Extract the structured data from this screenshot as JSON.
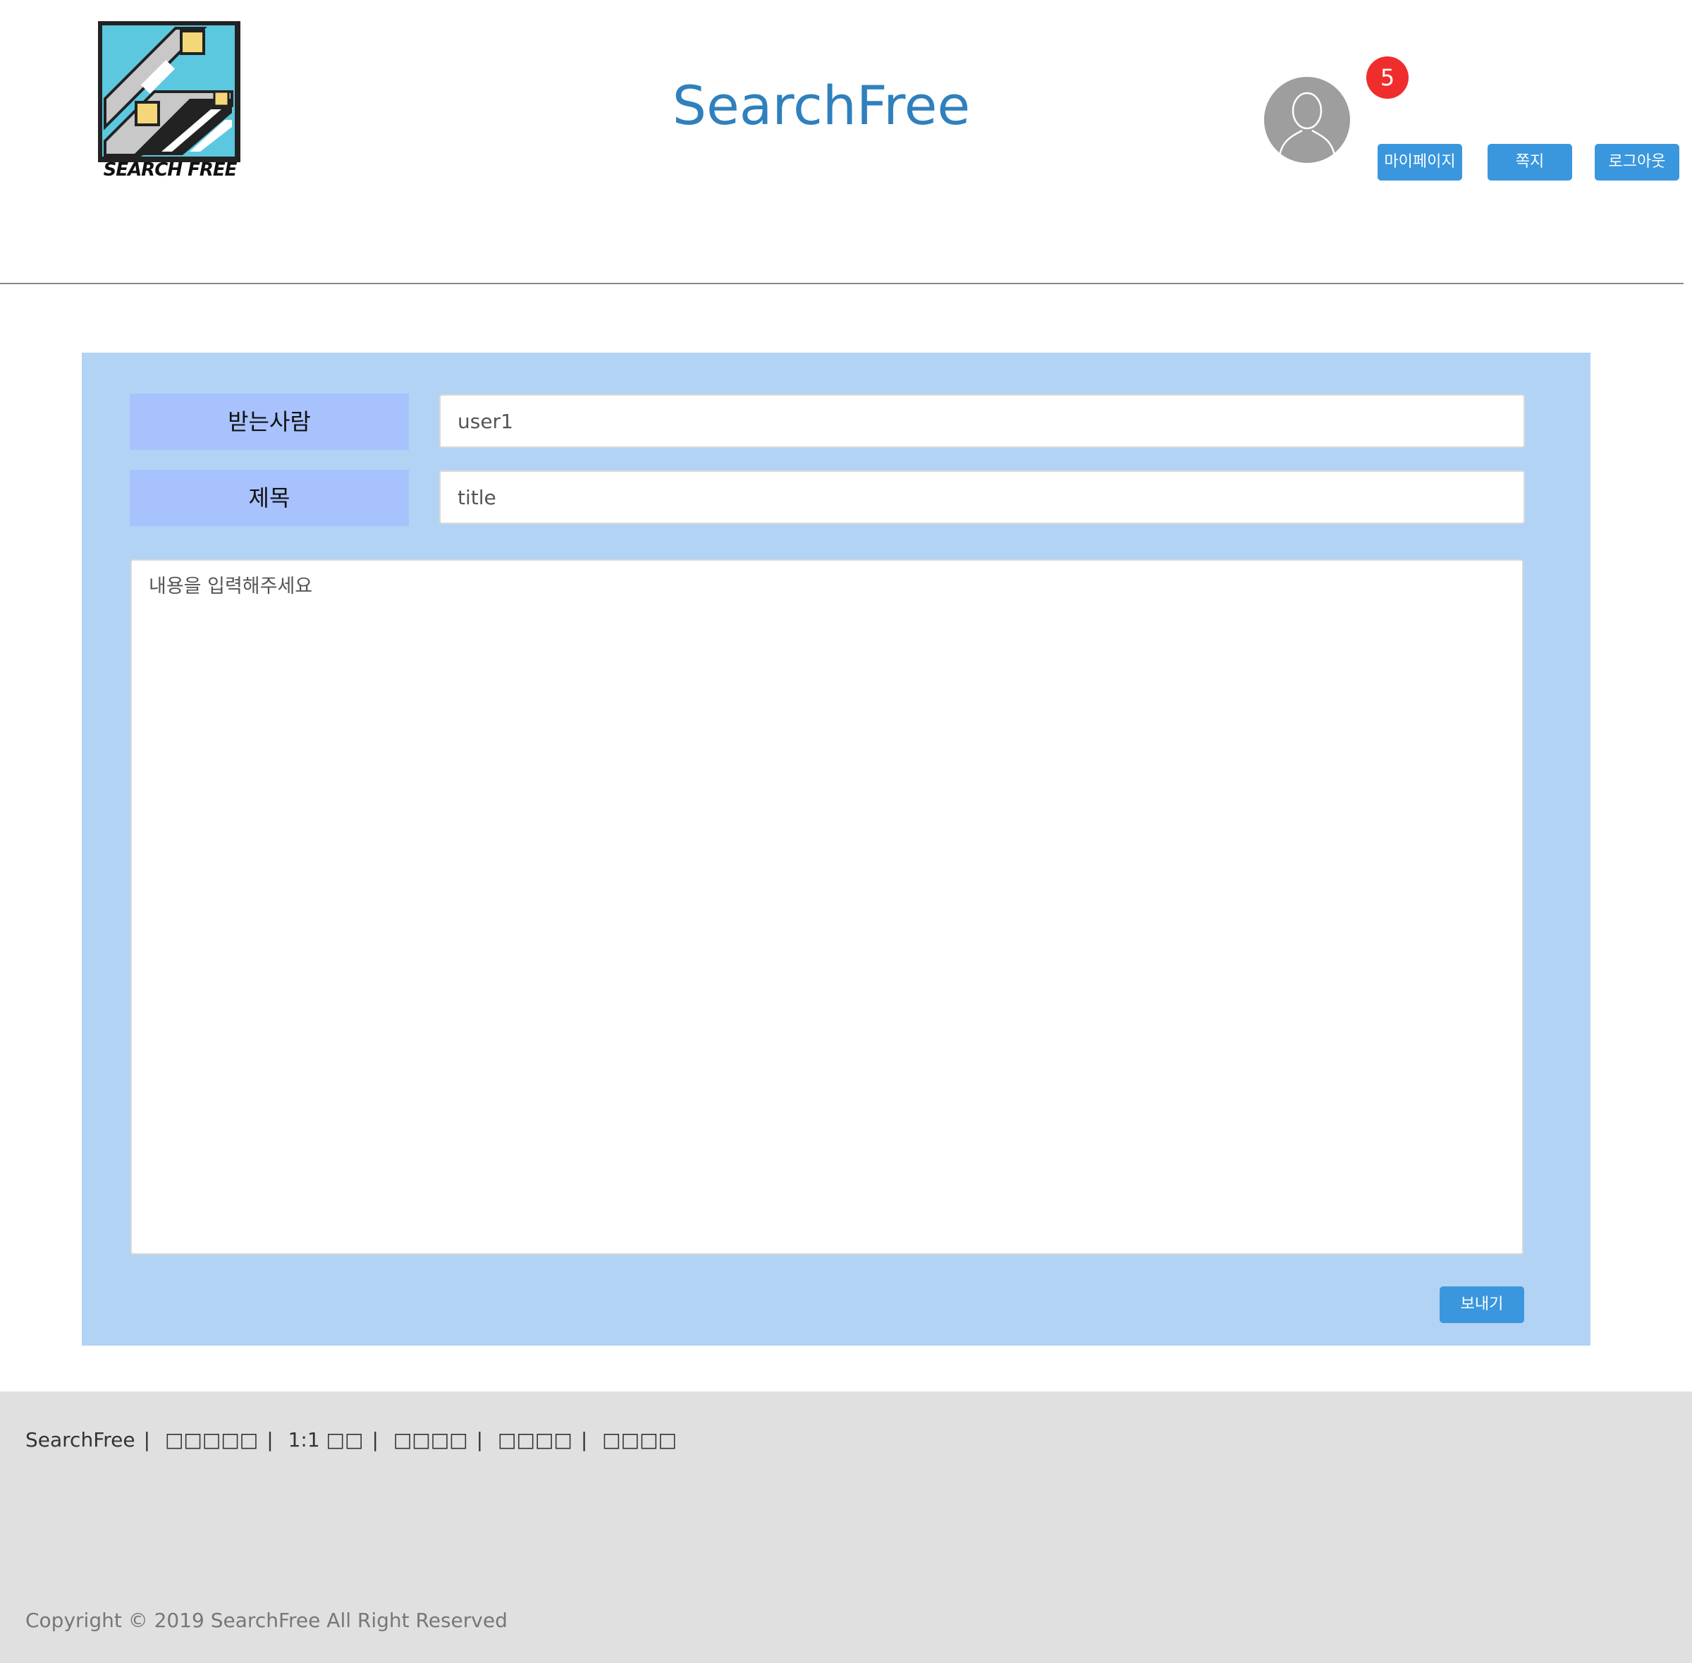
{
  "header": {
    "logo_text": "SEARCH FREE",
    "site_title": "SearchFree",
    "notification_count": "5",
    "buttons": {
      "mypage": "마이페이지",
      "note": "쪽지",
      "logout": "로그아웃"
    }
  },
  "form": {
    "recipient_label": "받는사람",
    "recipient_value": "user1",
    "title_label": "제목",
    "title_value": "title",
    "content_placeholder": "내용을 입력해주세요",
    "send_label": "보내기"
  },
  "footer": {
    "brand": "SearchFree",
    "links": [
      "□□□□□",
      "1:1 □□",
      "□□□□",
      "□□□□",
      "□□□□"
    ],
    "copyright": "Copyright © 2019 SearchFree All Right Reserved"
  },
  "colors": {
    "accent": "#3a97de",
    "title": "#2f80bd",
    "panel": "#b3d3f5",
    "label": "#a8c2fd",
    "badge": "#f02d2d",
    "footer": "#e0e0e0"
  },
  "icons": {
    "logo": "search-free-logo",
    "avatar": "user-silhouette-icon"
  }
}
